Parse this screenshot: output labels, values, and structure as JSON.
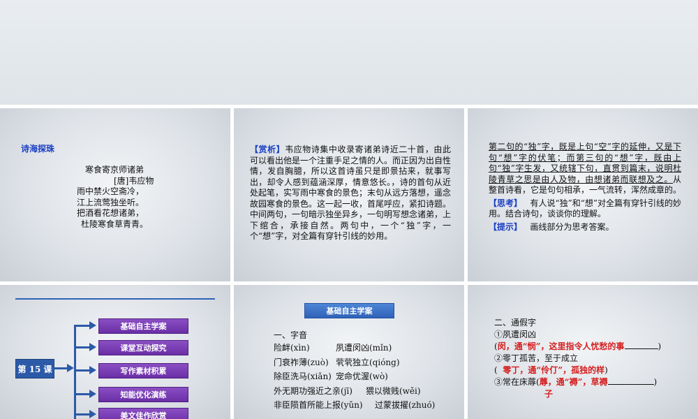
{
  "slide1": {
    "section_title": "诗海探珠",
    "poem_title": "寒食寄京师诸弟",
    "author": "[唐]韦应物",
    "lines": [
      "雨中禁火空斋冷，",
      "江上流莺独坐听。",
      "把酒看花想诸弟，",
      "杜陵寒食草青青。"
    ]
  },
  "slide2": {
    "tag": "【赏析】",
    "text": "韦应物诗集中收录寄诸弟诗近二十首，由此可以看出他是一个注重手足之情的人。而正因为出自性情，发自胸臆，所以这首诗虽只是即景拈来，就事写出，却令人感到蕴涵深厚，情意悠长。，诗的首句从近处起笔，实写雨中寒食的景色；末句从远方落想，遥念故园寒食的景色。这一起一收，首尾呼应，紧扣诗题。中间两句，一句暗示独坐异乡，一句明写想念诸弟，上下绾合，承接自然。两句中，一个“独”字，一个“想”字，对全篇有穿针引线的妙用。"
  },
  "slide3": {
    "underlined_text": "第二句的“独”字，既是上句“空”字的延伸，又是下句“想”字的伏笔；而第三句的“想”字，既由上句“独”字生发，又统辖下句，直贯到篇末，说明杜陵青草之思是由人及物，由想诸弟而联想及之。",
    "plain_text": "从整首诗看，它是句句相承，一气流转，浑然成章的。",
    "think_tag": "【思考】",
    "think_text": "有人说“独”和“想”对全篇有穿针引线的妙用。结合诗句，谈谈你的理解。",
    "hint_tag": "【提示】",
    "hint_text": "画线部分为思考答案。"
  },
  "slide4": {
    "lesson_label": "第 15 课",
    "menu": [
      "基础自主学案",
      "课堂互动探究",
      "写作素材积累",
      "知能优化演练",
      "美文佳作欣赏"
    ]
  },
  "slide5": {
    "header": "基础自主学案",
    "section": "一、字音",
    "rows": [
      [
        "险衅(xìn)",
        "夙遭闵凶(mǐn)"
      ],
      [
        "门衰祚薄(zuò)",
        "茕茕独立(qióng)"
      ],
      [
        "除臣洗马(xiǎn)",
        "宠命优渥(wò)"
      ],
      [
        "外无期功强近之亲(jī)",
        "猥以微贱(wěi)"
      ],
      [
        "非臣陨首所能上报(yǔn)",
        "过蒙拔擢(zhuó)"
      ]
    ]
  },
  "slide6": {
    "section": "二、通假字",
    "items": [
      {
        "label": "①夙遭闵凶",
        "answer": "闵，通“悯”，这里指令人忧愁的事"
      },
      {
        "label": "②零丁孤苦，至于成立",
        "answer": "零丁，通“伶仃”，孤独的样"
      },
      {
        "label": "③常在床蓐",
        "answer": "蓐，通“褥”，草褥",
        "answer_cont": "子"
      }
    ]
  },
  "colors": {
    "blue_accent": "#1a3fc4",
    "menu_purple": "#7a3cb8",
    "tree_blue": "#2c5aa8",
    "answer_red": "#d42020"
  }
}
